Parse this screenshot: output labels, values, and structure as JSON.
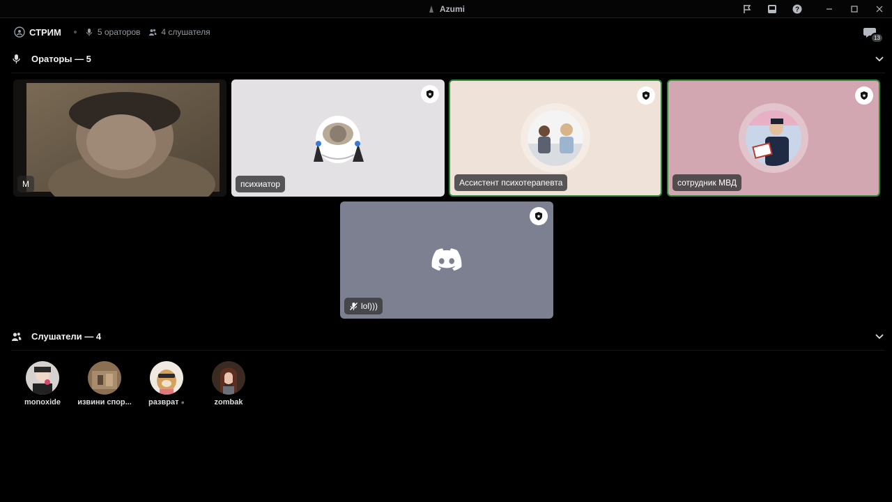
{
  "window": {
    "title": "Azumi",
    "icons": [
      "flag-icon",
      "inbox-icon",
      "help-icon",
      "minimize-icon",
      "maximize-icon",
      "close-icon"
    ]
  },
  "stage": {
    "name": "СТРИМ",
    "speakers_count_label": "5 ораторов",
    "listeners_count_label": "4 слушателя",
    "chat_badge": "13"
  },
  "sections": {
    "speakers_title": "Ораторы — 5",
    "listeners_title": "Слушатели — 4"
  },
  "speakers": [
    {
      "name": "M",
      "type": "video",
      "moderator": false,
      "speaking": false
    },
    {
      "name": "психиатор",
      "type": "avatar",
      "moderator": true,
      "speaking": false,
      "bg": "#e3e1e4"
    },
    {
      "name": "Ассистент психотерапевта",
      "type": "avatar",
      "moderator": true,
      "speaking": true,
      "bg": "#efe2d8"
    },
    {
      "name": "сотрудник МВД",
      "type": "avatar",
      "moderator": true,
      "speaking": true,
      "bg": "#d3a7b1"
    },
    {
      "name": "lol)))",
      "type": "default-avatar",
      "moderator": true,
      "speaking": false,
      "muted": true,
      "bg": "#7c8090"
    }
  ],
  "listeners": [
    {
      "name": "monoxide"
    },
    {
      "name": "извини спор..."
    },
    {
      "name": "разврат"
    },
    {
      "name": "zombak"
    }
  ],
  "colors": {
    "background": "#000000",
    "speaking_border": "#2e8b3a",
    "chip_bg": "#3c3c3e"
  }
}
